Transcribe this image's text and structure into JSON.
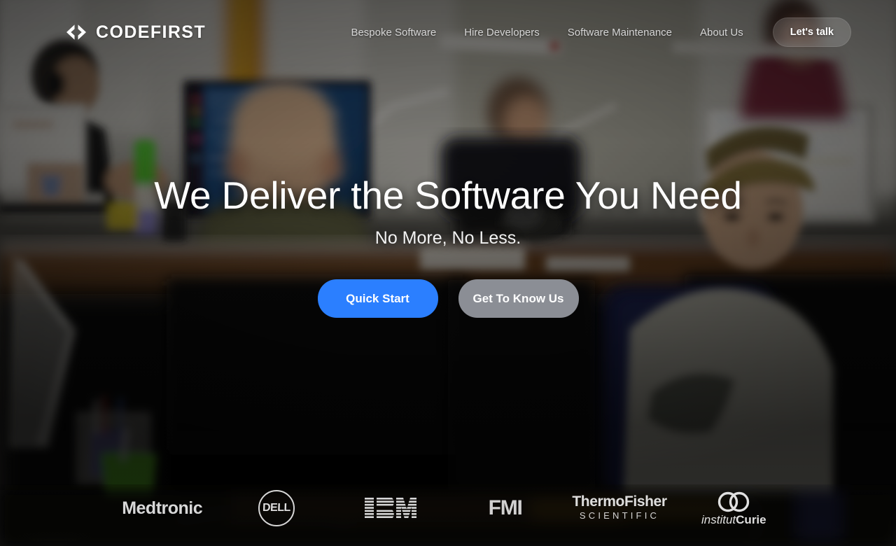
{
  "header": {
    "brand": {
      "name": "CODEFIRST",
      "icon": "code-brackets-icon"
    },
    "nav": [
      {
        "label": "Bespoke Software"
      },
      {
        "label": "Hire Developers"
      },
      {
        "label": "Software Maintenance"
      },
      {
        "label": "About Us"
      }
    ],
    "cta": {
      "label": "Let's talk"
    }
  },
  "hero": {
    "title": "We Deliver the Software You Need",
    "subtitle": "No More, No Less.",
    "primary_cta": "Quick Start",
    "secondary_cta": "Get To Know Us"
  },
  "clients": {
    "medtronic": "Medtronic",
    "dell": "DELL",
    "ibm": "IBM",
    "fmi": "FMI",
    "thermofisher_line1": "ThermoFisher",
    "thermofisher_line2": "SCIENTIFIC",
    "curie_light": "institut",
    "curie_bold": "Curie"
  },
  "colors": {
    "primary_blue": "#2b7fff",
    "secondary_grey": "#8b8e95",
    "text_white": "#ffffff",
    "nav_grey": "#d5d5d5"
  }
}
